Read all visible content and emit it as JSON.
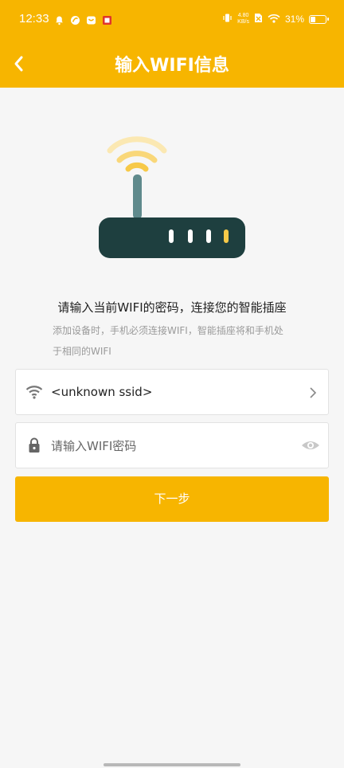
{
  "status_bar": {
    "time": "12:33",
    "net_speed_value": "4.80",
    "net_speed_unit": "KB/s",
    "battery": "31%"
  },
  "nav": {
    "title": "输入WIFI信息"
  },
  "main": {
    "heading": "请输入当前WIFI的密码，连接您的智能插座",
    "subtext": "添加设备时，手机必须连接WIFI，智能插座将和手机处于相同的WIFI"
  },
  "form": {
    "ssid_value": "<unknown ssid>",
    "password_placeholder": "请输入WIFI密码",
    "next_label": "下一步"
  },
  "colors": {
    "accent": "#f7b500",
    "router_body": "#1e3f3f",
    "antenna": "#5f8a8c",
    "signal": "#f7c948"
  }
}
